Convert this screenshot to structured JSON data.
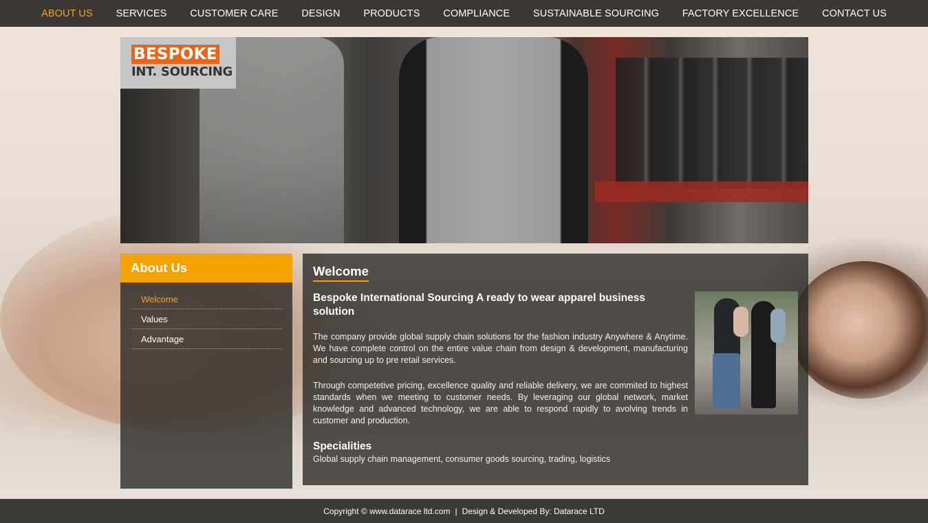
{
  "nav": {
    "items": [
      {
        "label": "ABOUT US",
        "active": true
      },
      {
        "label": "SERVICES"
      },
      {
        "label": "CUSTOMER CARE"
      },
      {
        "label": "DESIGN"
      },
      {
        "label": "PRODUCTS"
      },
      {
        "label": "COMPLIANCE"
      },
      {
        "label": "SUSTAINABLE SOURCING"
      },
      {
        "label": "FACTORY EXCELLENCE"
      },
      {
        "label": "CONTACT US"
      }
    ]
  },
  "logo": {
    "line1": "BESPOKE",
    "line2": "INT. SOURCING"
  },
  "sidebar": {
    "title": "About Us",
    "items": [
      {
        "label": "Welcome",
        "active": true
      },
      {
        "label": "Values"
      },
      {
        "label": "Advantage"
      }
    ]
  },
  "main": {
    "title": "Welcome",
    "subtitle": "Bespoke International Sourcing A ready to wear apparel business solution",
    "paragraphs": [
      "The company provide global supply chain solutions for the fashion industry Anywhere & Anytime. We have complete control on the entire value chain from design & development, manufacturing and sourcing up to pre retail services.",
      "Through competetive pricing, excellence quality and reliable delivery, we are commited to highest standards when we meeting to customer needs. By leveraging our global network, market knowledge and advanced technology, we are able to respond rapidly to avolving trends in customer and production."
    ],
    "specialities_title": "Specialities",
    "specialities_text": "Global supply chain management, consumer goods sourcing, trading, logistics"
  },
  "footer": {
    "copyright": "Copyright © www.datarace ltd.com",
    "separator": "|",
    "credit": "Design & Developed By: Datarace LTD"
  },
  "colors": {
    "accent": "#f5a100",
    "nav_active": "#f5a21e",
    "logo_orange": "#e8651a",
    "panel": "#282624"
  }
}
